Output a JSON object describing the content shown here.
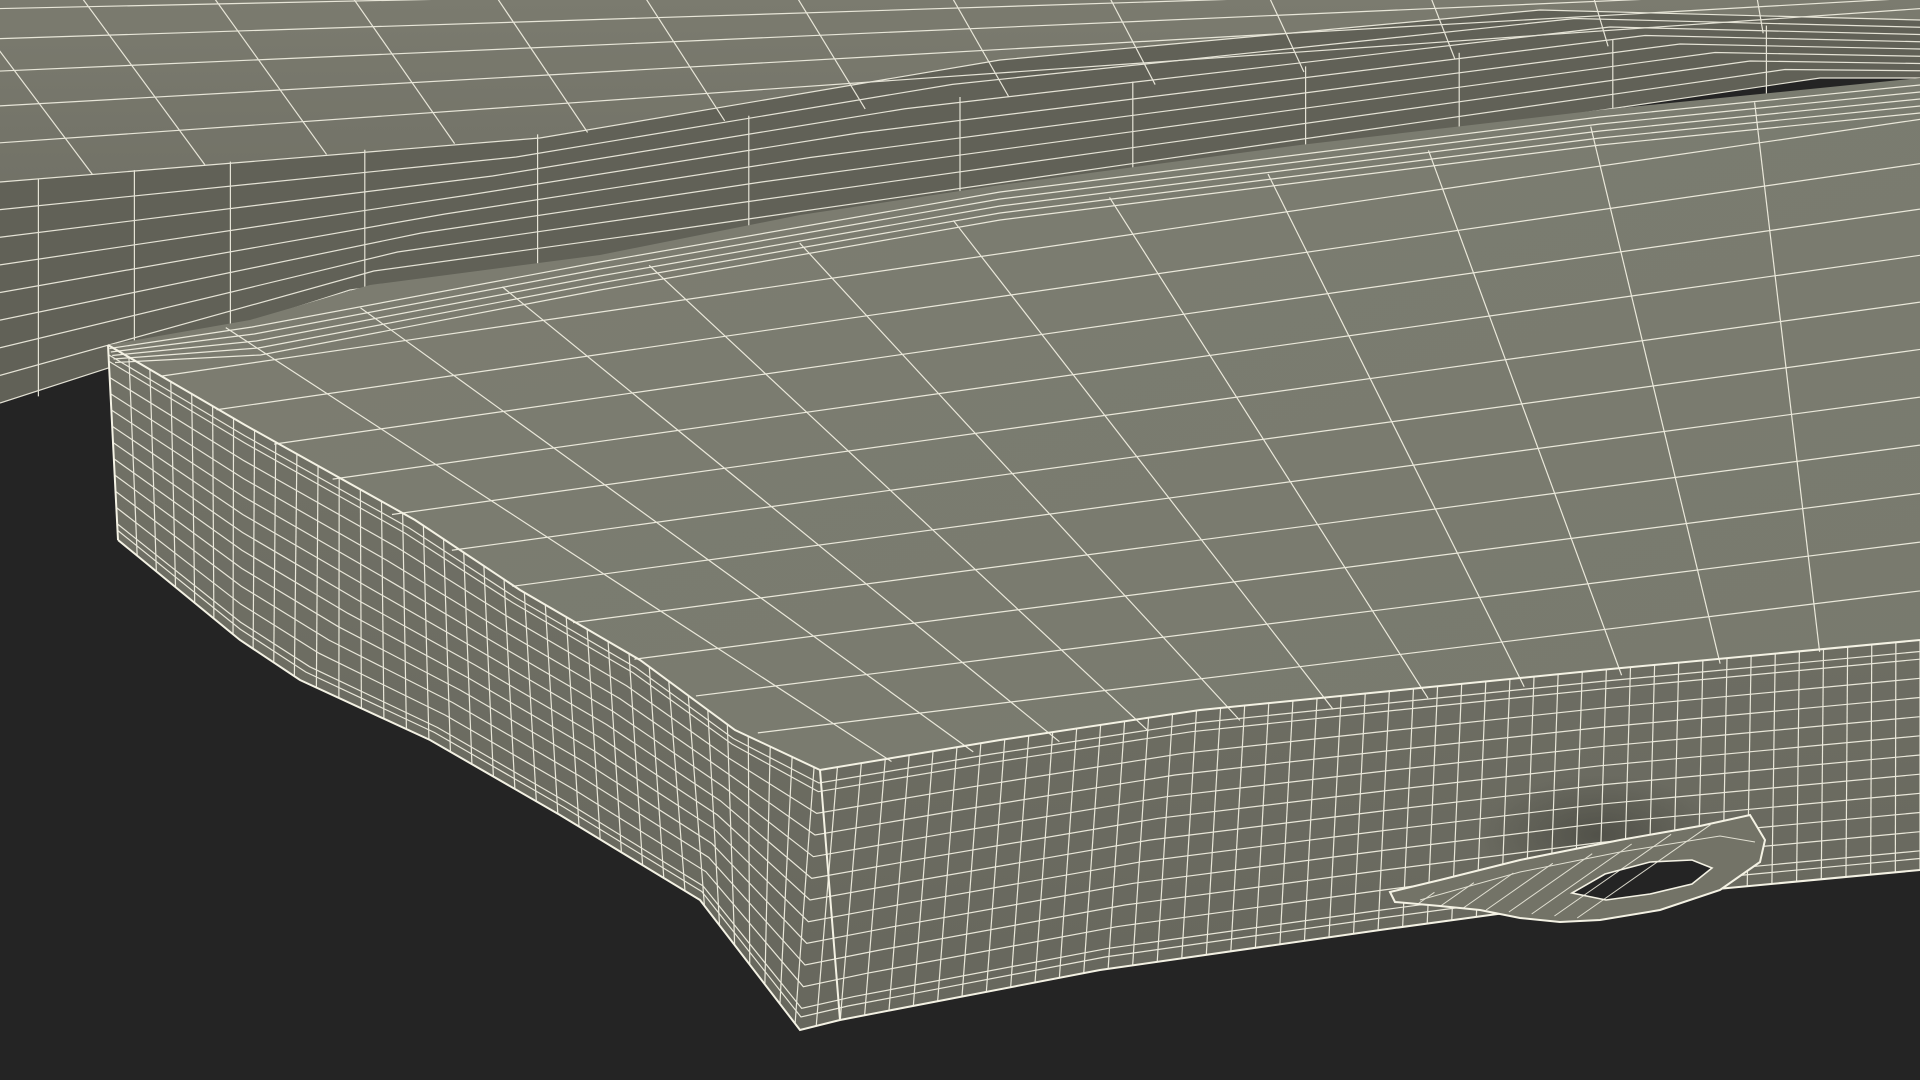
{
  "scene": {
    "subject": "wireframe-render",
    "background_color": "#242424",
    "surface_color": "#7a7a6e",
    "surface_shadow_color": "#5f5f55",
    "side_color": "#6e6e63",
    "wire_color": "#f4f2e4",
    "objects": [
      "back-mat",
      "front-mat",
      "carry-handle"
    ]
  }
}
